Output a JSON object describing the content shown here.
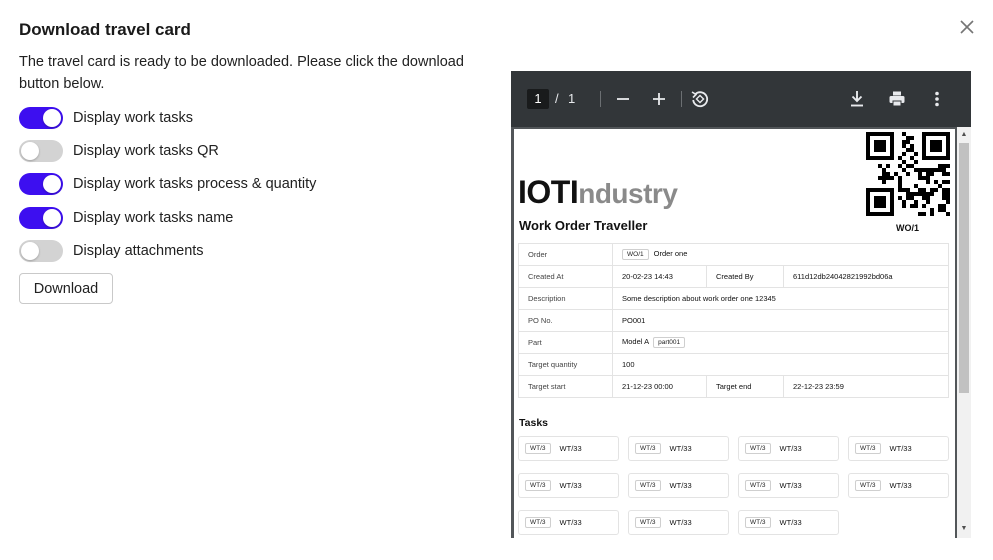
{
  "dialog": {
    "title": "Download travel card",
    "description": "The travel card is ready to be downloaded. Please click the download button below.",
    "toggles": [
      {
        "label": "Display work tasks",
        "on": true
      },
      {
        "label": "Display work tasks QR",
        "on": false
      },
      {
        "label": "Display work tasks process & quantity",
        "on": true
      },
      {
        "label": "Display work tasks name",
        "on": true
      },
      {
        "label": "Display attachments",
        "on": false
      }
    ],
    "download_label": "Download",
    "accent_color": "#3d0ff0"
  },
  "viewer": {
    "page_current": "1",
    "page_sep": "/",
    "page_total": "1",
    "icons": [
      "zoom-out-icon",
      "zoom-in-icon",
      "rotate-icon",
      "download-icon",
      "print-icon",
      "more-vert-icon"
    ]
  },
  "document": {
    "logo_bold": "IOTI",
    "logo_light": "ndustry",
    "qr_label": "WO/1",
    "title": "Work Order Traveller",
    "fields": {
      "order_label": "Order",
      "order_tag": "WO/1",
      "order_value": "Order one",
      "created_at_label": "Created At",
      "created_at_value": "20-02-23 14:43",
      "created_by_label": "Created By",
      "created_by_value": "611d12db24042821992bd06a",
      "description_label": "Description",
      "description_value": "Some description about work order one 12345",
      "po_label": "PO No.",
      "po_value": "PO001",
      "part_label": "Part",
      "part_value": "Model A",
      "part_tag": "part001",
      "target_qty_label": "Target quantity",
      "target_qty_value": "100",
      "target_start_label": "Target start",
      "target_start_value": "21-12-23 00:00",
      "target_end_label": "Target end",
      "target_end_value": "22-12-23 23:59"
    },
    "tasks_title": "Tasks",
    "tasks": [
      {
        "tag": "WT/3",
        "name": "WT/33"
      },
      {
        "tag": "WT/3",
        "name": "WT/33"
      },
      {
        "tag": "WT/3",
        "name": "WT/33"
      },
      {
        "tag": "WT/3",
        "name": "WT/33"
      },
      {
        "tag": "WT/3",
        "name": "WT/33"
      },
      {
        "tag": "WT/3",
        "name": "WT/33"
      },
      {
        "tag": "WT/3",
        "name": "WT/33"
      },
      {
        "tag": "WT/3",
        "name": "WT/33"
      },
      {
        "tag": "WT/3",
        "name": "WT/33"
      },
      {
        "tag": "WT/3",
        "name": "WT/33"
      },
      {
        "tag": "WT/3",
        "name": "WT/33"
      }
    ]
  }
}
